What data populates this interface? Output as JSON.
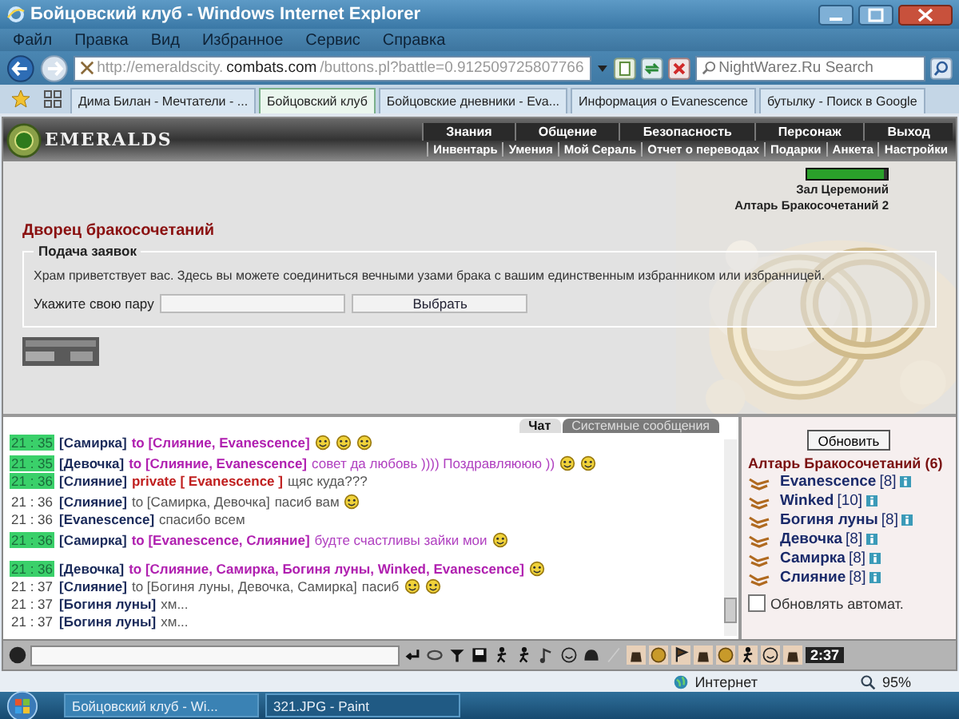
{
  "window": {
    "title": "Бойцовский клуб - Windows Internet Explorer"
  },
  "menu": [
    "Файл",
    "Правка",
    "Вид",
    "Избранное",
    "Сервис",
    "Справка"
  ],
  "address_bar": {
    "prefix": "http://emeraldscity.",
    "domain": "combats.com",
    "path": "/buttons.pl?battle=0.912509725807766"
  },
  "search": {
    "placeholder": "NightWarez.Ru Search"
  },
  "tabs": [
    {
      "label": "Дима Билан - Мечтатели - ...",
      "selected": false
    },
    {
      "label": "Бойцовский клуб",
      "selected": true
    },
    {
      "label": "Бойцовские дневники - Eva...",
      "selected": false
    },
    {
      "label": "Информация о Evanescence",
      "selected": false
    },
    {
      "label": "бутылку - Поиск в Google",
      "selected": false
    }
  ],
  "game": {
    "logo": "EMERALDS",
    "nav_top": [
      "Знания",
      "Общение",
      "Безопасность",
      "Персонаж",
      "Выход"
    ],
    "nav_bottom": [
      "Инвентарь",
      "Умения",
      "Мой Сераль",
      "Отчет о переводах",
      "Подарки",
      "Анкета",
      "Настройки"
    ],
    "health": {
      "level": 0.95
    },
    "locations": [
      "Зал Церемоний",
      "Алтарь Бракосочетаний 2"
    ],
    "heading": "Дворец бракосочетаний",
    "form": {
      "legend": "Подача заявок",
      "intro": "Храм приветствует вас. Здесь вы можете соединиться вечными узами брака с вашим единственным избранником или избранницей.",
      "pair_label": "Укажите свою пару",
      "button": "Выбрать"
    }
  },
  "chat": {
    "tabs": [
      {
        "label": "Чат",
        "selected": true
      },
      {
        "label": "Системные сообщения",
        "selected": false
      }
    ],
    "messages": [
      {
        "time": "21 : 35",
        "highlighted": true,
        "sender": "[Самирка]",
        "kind": "to",
        "address": "to [Слияние, Evanescence]"
      },
      {
        "time": "21 : 35",
        "highlighted": true,
        "sender": "[Девочка]",
        "kind": "to",
        "address": "to [Слияние, Evanescence]",
        "text": "совет да любовь )))) Поздравляююю ))"
      },
      {
        "time": "21 : 36",
        "highlighted": true,
        "sender": "[Слияние]",
        "kind": "private",
        "address": "private [ Evanescence ]",
        "text": "щяс куда???"
      },
      {
        "time": "21 : 36",
        "highlighted": false,
        "sender": "[Слияние]",
        "kind": "to",
        "address": "to [Самирка, Девочка]",
        "text": "пасиб вам"
      },
      {
        "time": "21 : 36",
        "highlighted": false,
        "sender": "[Evanescence]",
        "kind": "say",
        "text": "спасибо всем"
      },
      {
        "time": "21 : 36",
        "highlighted": true,
        "sender": "[Самирка]",
        "kind": "to",
        "address": "to [Evanescence, Слияние]",
        "text": "будте счастливы зайки мои"
      },
      {
        "time": "21 : 36",
        "highlighted": true,
        "sender": "[Девочка]",
        "kind": "to",
        "address": "to [Слияние, Самирка, Богиня луны, Winked, Evanescence]"
      },
      {
        "time": "21 : 37",
        "highlighted": false,
        "sender": "[Слияние]",
        "kind": "to",
        "address": "to [Богиня луны, Девочка, Самирка]",
        "text": "пасиб"
      },
      {
        "time": "21 : 37",
        "highlighted": false,
        "sender": "[Богиня луны]",
        "kind": "say",
        "text": "хм..."
      },
      {
        "time": "21 : 37",
        "highlighted": false,
        "sender": "[Богиня луны]",
        "kind": "say",
        "text": "хм..."
      }
    ]
  },
  "room": {
    "refresh_button": "Обновить",
    "title": "Алтарь Бракосочетаний (6)",
    "users": [
      {
        "name": "Evanescence",
        "rank": "[8]"
      },
      {
        "name": "Winked",
        "rank": "[10]"
      },
      {
        "name": "Богиня луны",
        "rank": "[8]"
      },
      {
        "name": "Девочка",
        "rank": "[8]"
      },
      {
        "name": "Самирка",
        "rank": "[8]"
      },
      {
        "name": "Слияние",
        "rank": "[8]"
      }
    ],
    "auto_refresh": {
      "label": "Обновлять автомат.",
      "checked": false
    }
  },
  "toolbar": {
    "clock": "2:37"
  },
  "status_bar": {
    "zone": "Интернет",
    "zoom": "95%"
  },
  "taskbar": [
    {
      "label": "Бойцовский клуб - Wi...",
      "selected": true
    },
    {
      "label": "321.JPG - Paint",
      "selected": false
    }
  ]
}
